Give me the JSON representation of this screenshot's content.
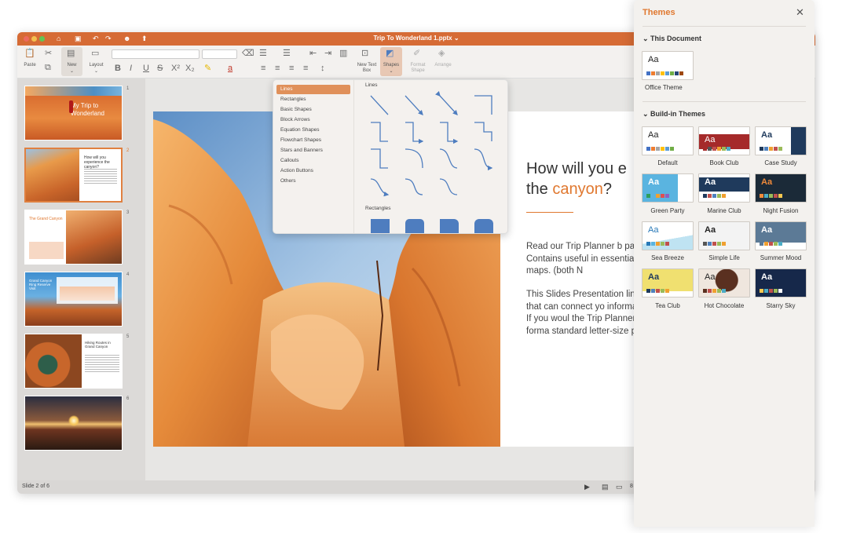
{
  "window": {
    "title": "Trip To Wonderland 1.pptx ⌄"
  },
  "toolbar": {
    "paste": "Paste",
    "new": "New",
    "layout": "Layout",
    "new_text_box": "New Text\nBox",
    "shapes": "Shapes",
    "format_shape": "Format\nShape",
    "arrange": "Arrange"
  },
  "thumbnails": [
    {
      "num": "1",
      "text": "My Trip to Wonderland"
    },
    {
      "num": "2",
      "text": "How will you experience the canyon?"
    },
    {
      "num": "3",
      "text": "The Grand Canyon"
    },
    {
      "num": "4",
      "text": "Grand Canyon Ring Reserve Visit"
    },
    {
      "num": "5",
      "text": "Hiking Routes in Grand Canyon"
    },
    {
      "num": "6",
      "text": ""
    }
  ],
  "slide": {
    "heading_line1": "How will you e",
    "heading_pre": "the ",
    "heading_accent": "canyon",
    "heading_post": "?",
    "para1": "Read our Trip Planner b park. Contains useful in essential maps. (both N",
    "para2": "This Slides Presentation links that can connect yo information, If you woul the Trip Planner is forma standard letter-size pap"
  },
  "status": {
    "slide_info": "Slide 2 of 6",
    "zoom_partial": "8"
  },
  "shapes_menu": {
    "categories": [
      "Lines",
      "Rectangles",
      "Basic Shapes",
      "Block Arrows",
      "Equation Shapes",
      "Flowchart Shapes",
      "Stars and Banners",
      "Callouts",
      "Action Buttons",
      "Others"
    ],
    "selected": "Lines",
    "section_lines": "Lines",
    "section_rectangles": "Rectangles"
  },
  "themes_panel": {
    "title": "Themes",
    "this_document": "This Document",
    "office_theme": "Office Theme",
    "build_in": "Build-in Themes",
    "themes": [
      "Default",
      "Book Club",
      "Case Study",
      "Green Party",
      "Marine Club",
      "Night Fusion",
      "Sea Breeze",
      "Simple Life",
      "Summer Mood",
      "Tea Club",
      "Hot Chocolate",
      "Starry Sky"
    ],
    "aa": "Aa"
  },
  "colors": {
    "accent": "#d66b35",
    "text_accent": "#e0782f"
  }
}
